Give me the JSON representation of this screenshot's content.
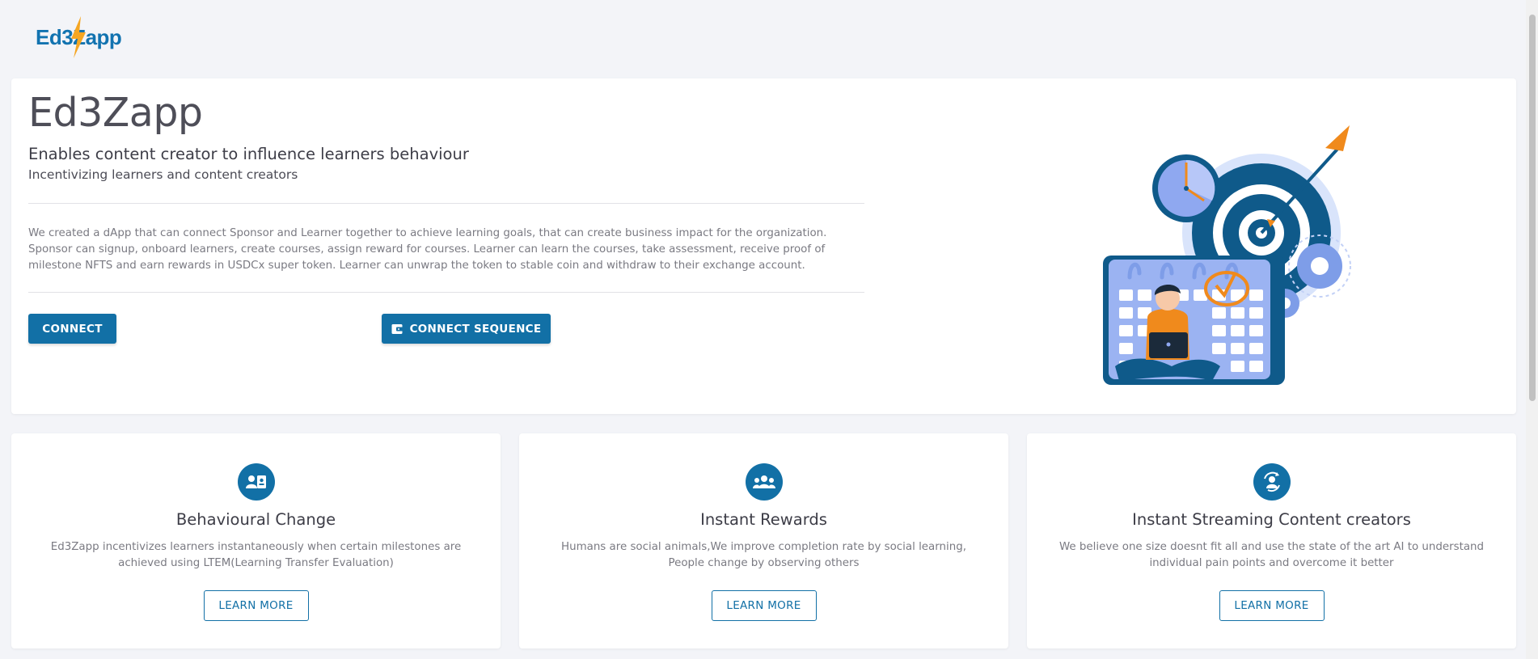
{
  "header": {
    "logo_text": "Ed3Zapp"
  },
  "hero": {
    "title": "Ed3Zapp",
    "subtitle": "Enables content creator to influence learners behaviour",
    "tagline": "Incentivizing learners and content creators",
    "description": "We created a dApp that can connect Sponsor and Learner together to achieve learning goals, that can create business impact for the organization. Sponsor can signup, onboard learners, create courses, assign reward for courses. Learner can learn the courses, take assessment, receive proof of milestone NFTS and earn rewards in USDCx super token. Learner can unwrap the token to stable coin and withdraw to their exchange account.",
    "connect_label": "CONNECT",
    "connect_sequence_label": "CONNECT SEQUENCE"
  },
  "features": [
    {
      "icon": "person-id-icon",
      "title": "Behavioural Change",
      "text": "Ed3Zapp incentivizes learners instantaneously when certain milestones are achieved using LTEM(Learning Transfer Evaluation)",
      "button": "LEARN MORE"
    },
    {
      "icon": "group-icon",
      "title": "Instant Rewards",
      "text": "Humans are social animals,We improve completion rate by social learning, People change by observing others",
      "button": "LEARN MORE"
    },
    {
      "icon": "person-sync-icon",
      "title": "Instant Streaming Content creators",
      "text": "We believe one size doesnt fit all and use the state of the art AI to understand individual pain points and overcome it better",
      "button": "LEARN MORE"
    }
  ],
  "colors": {
    "primary": "#1270a6",
    "background": "#f3f4f8",
    "accent": "#f08a1c"
  }
}
